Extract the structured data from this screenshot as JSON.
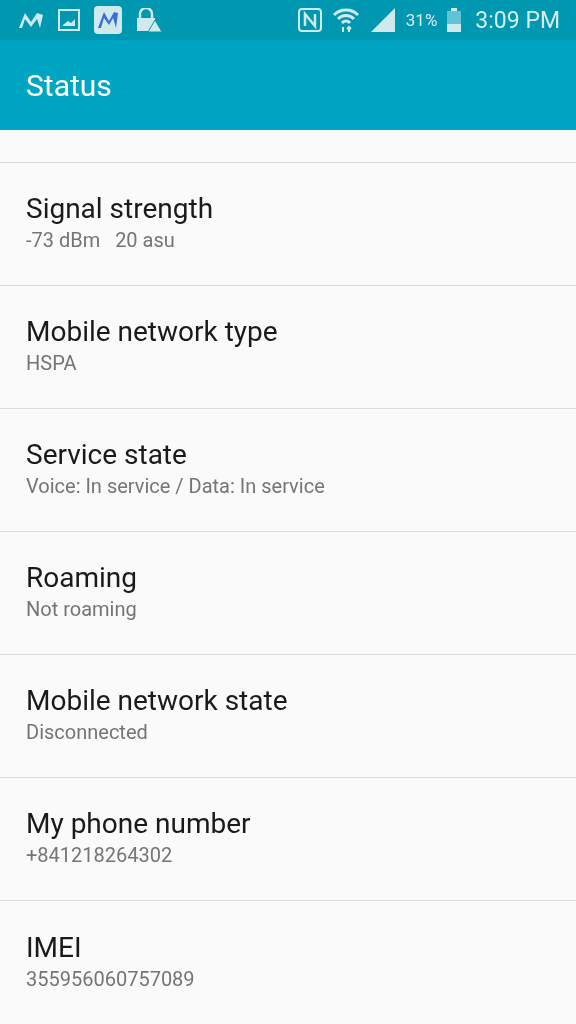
{
  "status_bar": {
    "battery_text": "31%",
    "time": "3:09 PM"
  },
  "app_bar": {
    "title": "Status"
  },
  "items": [
    {
      "title": "Signal strength",
      "value": "-73 dBm   20 asu"
    },
    {
      "title": "Mobile network type",
      "value": "HSPA"
    },
    {
      "title": "Service state",
      "value": "Voice: In service / Data: In service"
    },
    {
      "title": "Roaming",
      "value": "Not roaming"
    },
    {
      "title": "Mobile network state",
      "value": "Disconnected"
    },
    {
      "title": "My phone number",
      "value": "+841218264302"
    },
    {
      "title": "IMEI",
      "value": "355956060757089"
    }
  ]
}
